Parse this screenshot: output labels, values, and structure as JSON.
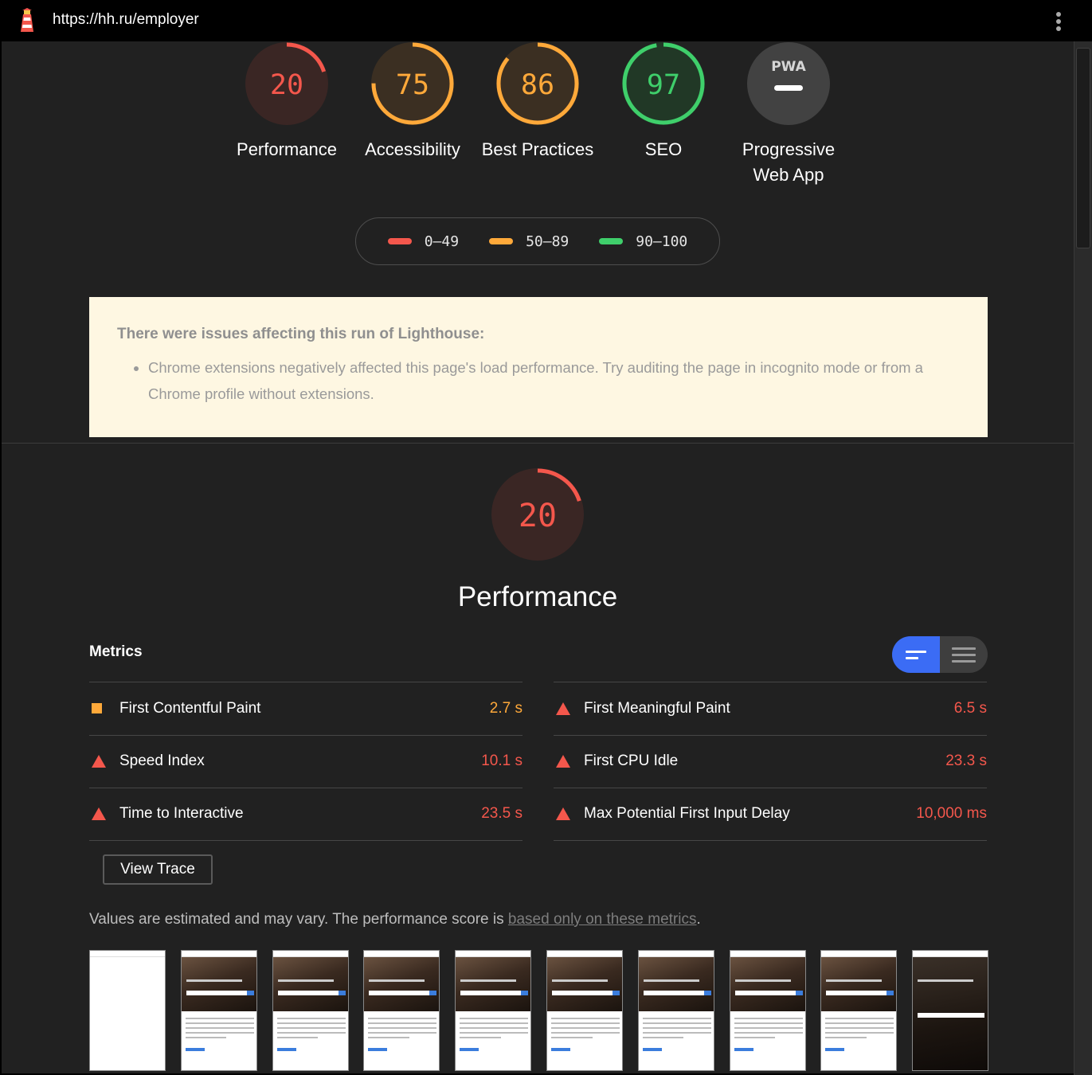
{
  "toolbar": {
    "url": "https://hh.ru/employer",
    "logo_icon": "lighthouse-icon",
    "menu_icon": "kebab-menu-icon"
  },
  "categories": [
    {
      "key": "performance",
      "score": "20",
      "label": "Performance",
      "color": "#f4574c",
      "bg": "#3a2624"
    },
    {
      "key": "accessibility",
      "score": "75",
      "label": "Accessibility",
      "color": "#ffa93a",
      "bg": "#3b2f22"
    },
    {
      "key": "best-practices",
      "score": "86",
      "label": "Best Practices",
      "color": "#ffa93a",
      "bg": "#3b2f22"
    },
    {
      "key": "seo",
      "score": "97",
      "label": "SEO",
      "color": "#3fcf6b",
      "bg": "#213826"
    },
    {
      "key": "pwa",
      "score": "",
      "label": "Progressive Web App",
      "badge": "PWA",
      "color": "#ffffff",
      "bg": "#424242"
    }
  ],
  "legend": [
    {
      "range": "0–49",
      "color": "#f4574c"
    },
    {
      "range": "50–89",
      "color": "#ffa93a"
    },
    {
      "range": "90–100",
      "color": "#3fcf6b"
    }
  ],
  "warning": {
    "title": "There were issues affecting this run of Lighthouse:",
    "items": [
      "Chrome extensions negatively affected this page's load performance. Try auditing the page in incognito mode or from a Chrome profile without extensions."
    ]
  },
  "performance_section": {
    "score": "20",
    "title": "Performance",
    "metrics_heading": "Metrics",
    "view_trace_label": "View Trace",
    "note_prefix": "Values are estimated and may vary. The performance score is ",
    "note_link": "based only on these metrics",
    "note_suffix": "."
  },
  "metrics_left": [
    {
      "name": "First Contentful Paint",
      "value": "2.7 s",
      "status": "average",
      "color": "#ffa93a"
    },
    {
      "name": "Speed Index",
      "value": "10.1 s",
      "status": "fail",
      "color": "#f4574c"
    },
    {
      "name": "Time to Interactive",
      "value": "23.5 s",
      "status": "fail",
      "color": "#f4574c"
    }
  ],
  "metrics_right": [
    {
      "name": "First Meaningful Paint",
      "value": "6.5 s",
      "status": "fail",
      "color": "#f4574c"
    },
    {
      "name": "First CPU Idle",
      "value": "23.3 s",
      "status": "fail",
      "color": "#f4574c"
    },
    {
      "name": "Max Potential First Input Delay",
      "value": "10,000 ms",
      "status": "fail",
      "color": "#f4574c"
    }
  ],
  "filmstrip": [
    "blank",
    "loaded",
    "loaded",
    "loaded",
    "loaded",
    "loaded",
    "loaded",
    "loaded",
    "loaded",
    "final"
  ]
}
